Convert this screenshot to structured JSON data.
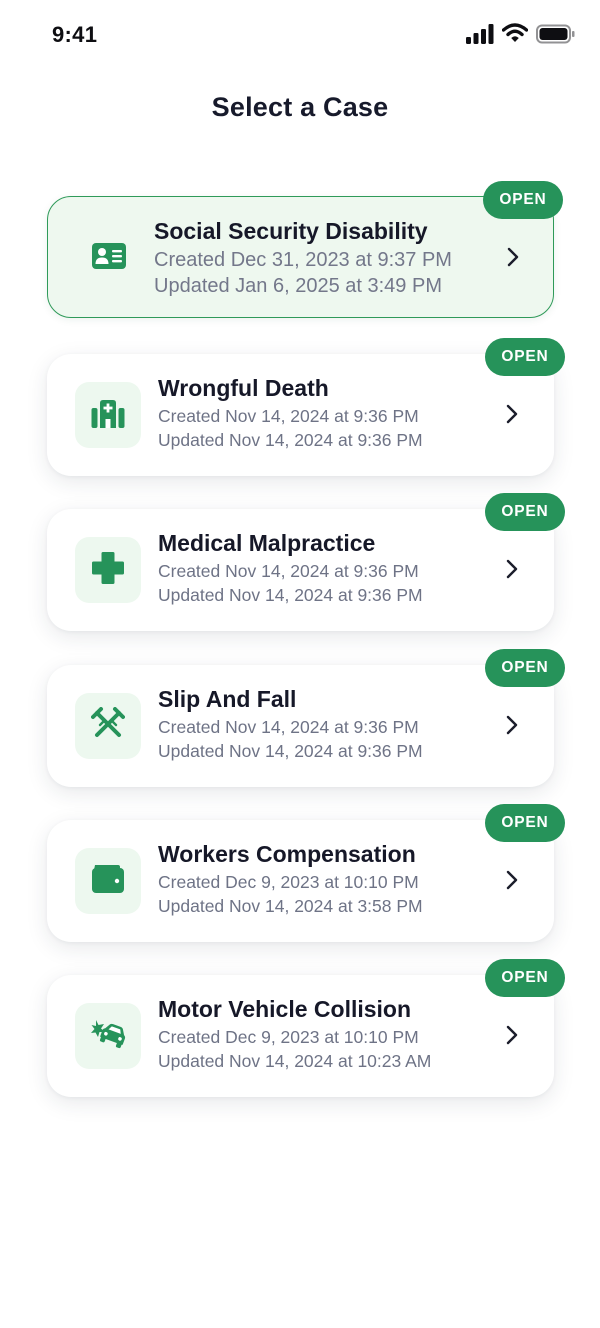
{
  "status_bar": {
    "time": "9:41",
    "icons": [
      "signal-icon",
      "wifi-icon",
      "battery-icon"
    ]
  },
  "page": {
    "title": "Select a Case"
  },
  "colors": {
    "accent": "#26935a",
    "selected_bg": "#eef8ef",
    "icon_bg": "#edf8ef",
    "text_primary": "#161828",
    "text_secondary": "#6e7386"
  },
  "cases": [
    {
      "name": "Social Security Disability",
      "created": "Created Dec 31, 2023 at 9:37 PM",
      "updated": "Updated Jan 6, 2025 at 3:49 PM",
      "status": "OPEN",
      "icon": "id-card-icon",
      "selected": true
    },
    {
      "name": "Wrongful Death",
      "created": "Created Nov 14, 2024 at 9:36 PM",
      "updated": "Updated Nov 14, 2024 at 9:36 PM",
      "status": "OPEN",
      "icon": "hospital-icon",
      "selected": false
    },
    {
      "name": "Medical Malpractice",
      "created": "Created Nov 14, 2024 at 9:36 PM",
      "updated": "Updated Nov 14, 2024 at 9:36 PM",
      "status": "OPEN",
      "icon": "medical-cross-icon",
      "selected": false
    },
    {
      "name": "Slip And Fall",
      "created": "Created Nov 14, 2024 at 9:36 PM",
      "updated": "Updated Nov 14, 2024 at 9:36 PM",
      "status": "OPEN",
      "icon": "crutches-icon",
      "selected": false
    },
    {
      "name": "Workers Compensation",
      "created": "Created Dec 9, 2023 at 10:10 PM",
      "updated": "Updated Nov 14, 2024 at 3:58 PM",
      "status": "OPEN",
      "icon": "wallet-icon",
      "selected": false
    },
    {
      "name": "Motor Vehicle Collision",
      "created": "Created Dec 9, 2023 at 10:10 PM",
      "updated": "Updated Nov 14, 2024 at 10:23 AM",
      "status": "OPEN",
      "icon": "car-crash-icon",
      "selected": false
    }
  ]
}
